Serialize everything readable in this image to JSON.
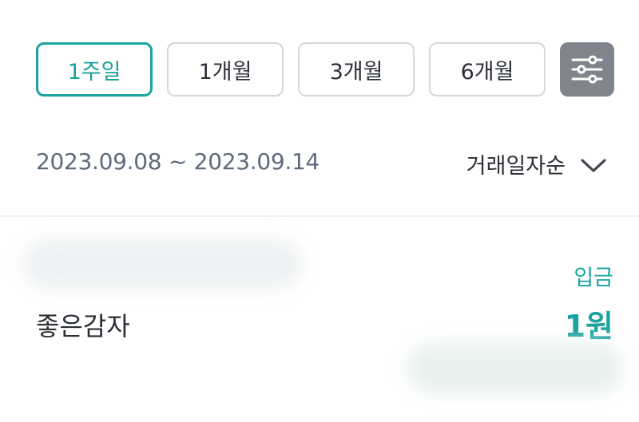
{
  "period_tabs": [
    {
      "label": "1주일",
      "active": true
    },
    {
      "label": "1개월",
      "active": false
    },
    {
      "label": "3개월",
      "active": false
    },
    {
      "label": "6개월",
      "active": false
    }
  ],
  "filter_icon": "sliders-icon",
  "date_range": "2023.09.08 ~ 2023.09.14",
  "sort": {
    "label": "거래일자순",
    "icon": "chevron-down-icon"
  },
  "transaction": {
    "type": "입금",
    "name": "좋은감자",
    "amount": "1원"
  },
  "colors": {
    "accent": "#1aa39f",
    "border": "#d4d7dc",
    "filter_bg": "#7f848d",
    "secondary_text": "#5d6b7d",
    "primary_text": "#2b2f36"
  }
}
